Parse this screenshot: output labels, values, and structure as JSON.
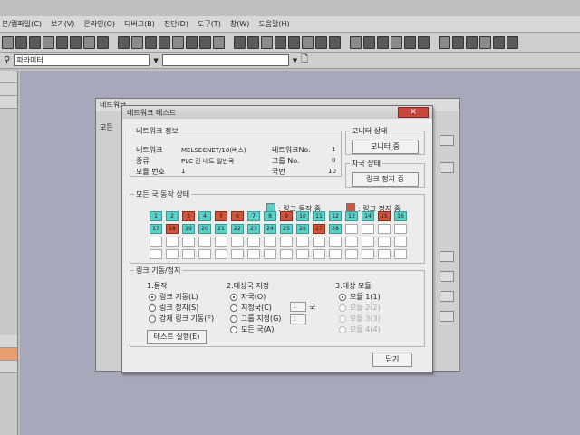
{
  "menubar": [
    "본/컴파일(C)",
    "보기(V)",
    "온라인(O)",
    "디버그(B)",
    "진단(D)",
    "도구(T)",
    "창(W)",
    "도움말(H)"
  ],
  "toolbar2": {
    "param_combo": "파라미터"
  },
  "back_window": {
    "title": "네트워크",
    "label": "모든"
  },
  "dialog": {
    "title": "네트워크 테스트",
    "close": "✕",
    "network_info": {
      "legend": "네트워크 정보",
      "network_label": "네트워크",
      "network_value": "MELSECNET/10(버스)",
      "type_label": "종류",
      "type_value": "PLC 간 네트 일반국",
      "module_label": "모듈 번호",
      "module_value": "1",
      "netno_label": "네트워크No.",
      "netno_value": "1",
      "group_label": "그룹 No.",
      "group_value": "0",
      "station_label": "국번",
      "station_value": "10"
    },
    "monitor": {
      "legend": "모니터 상태",
      "button": "모니터 중"
    },
    "self_status": {
      "legend": "자국 상태",
      "button": "링크 정지 중"
    },
    "all_stations": {
      "legend": "모든 국 동작 상태",
      "legend_running": ": 링크 동작 중",
      "legend_stopped": ": 링크 정지 중",
      "stations": [
        {
          "n": "1",
          "s": "c"
        },
        {
          "n": "2",
          "s": "c"
        },
        {
          "n": "3",
          "s": "r"
        },
        {
          "n": "4",
          "s": "c"
        },
        {
          "n": "5",
          "s": "r"
        },
        {
          "n": "6",
          "s": "r"
        },
        {
          "n": "7",
          "s": "c"
        },
        {
          "n": "8",
          "s": "c"
        },
        {
          "n": "9",
          "s": "r"
        },
        {
          "n": "10",
          "s": "c"
        },
        {
          "n": "11",
          "s": "c"
        },
        {
          "n": "12",
          "s": "c"
        },
        {
          "n": "13",
          "s": "c"
        },
        {
          "n": "14",
          "s": "c"
        },
        {
          "n": "15",
          "s": "r"
        },
        {
          "n": "16",
          "s": "c"
        },
        {
          "n": "17",
          "s": "c"
        },
        {
          "n": "18",
          "s": "r"
        },
        {
          "n": "19",
          "s": "c"
        },
        {
          "n": "20",
          "s": "c"
        },
        {
          "n": "21",
          "s": "c"
        },
        {
          "n": "22",
          "s": "c"
        },
        {
          "n": "23",
          "s": "c"
        },
        {
          "n": "24",
          "s": "c"
        },
        {
          "n": "25",
          "s": "c"
        },
        {
          "n": "26",
          "s": "c"
        },
        {
          "n": "27",
          "s": "r"
        },
        {
          "n": "28",
          "s": "c"
        }
      ],
      "blank_cells": 36,
      "colors": {
        "running": "#59d0c8",
        "stopped": "#d0553b"
      }
    },
    "link": {
      "legend": "링크 기동/정지",
      "action_title": "1:동작",
      "action_opts": [
        {
          "label": "링크 기동(L)",
          "on": true
        },
        {
          "label": "링크 정지(S)",
          "on": false
        },
        {
          "label": "강제 링크 기동(F)",
          "on": false
        }
      ],
      "target_title": "2:대상국 지정",
      "target_opts": [
        {
          "label": "자국(O)",
          "on": true
        },
        {
          "label": "지정국(C)",
          "on": false
        },
        {
          "label": "그룹 지정(G)",
          "on": false
        },
        {
          "label": "모든 국(A)",
          "on": false
        }
      ],
      "target_unit": "국",
      "target_in1": "1",
      "target_in2": "1",
      "module_title": "3:대상 모듈",
      "module_opts": [
        {
          "label": "모듈 1(1)",
          "on": true,
          "dis": false
        },
        {
          "label": "모듈 2(2)",
          "on": false,
          "dis": true
        },
        {
          "label": "모듈 3(3)",
          "on": false,
          "dis": true
        },
        {
          "label": "모듈 4(4)",
          "on": false,
          "dis": true
        }
      ],
      "run_button": "테스트 실행(E)"
    },
    "close_button": "닫기"
  }
}
